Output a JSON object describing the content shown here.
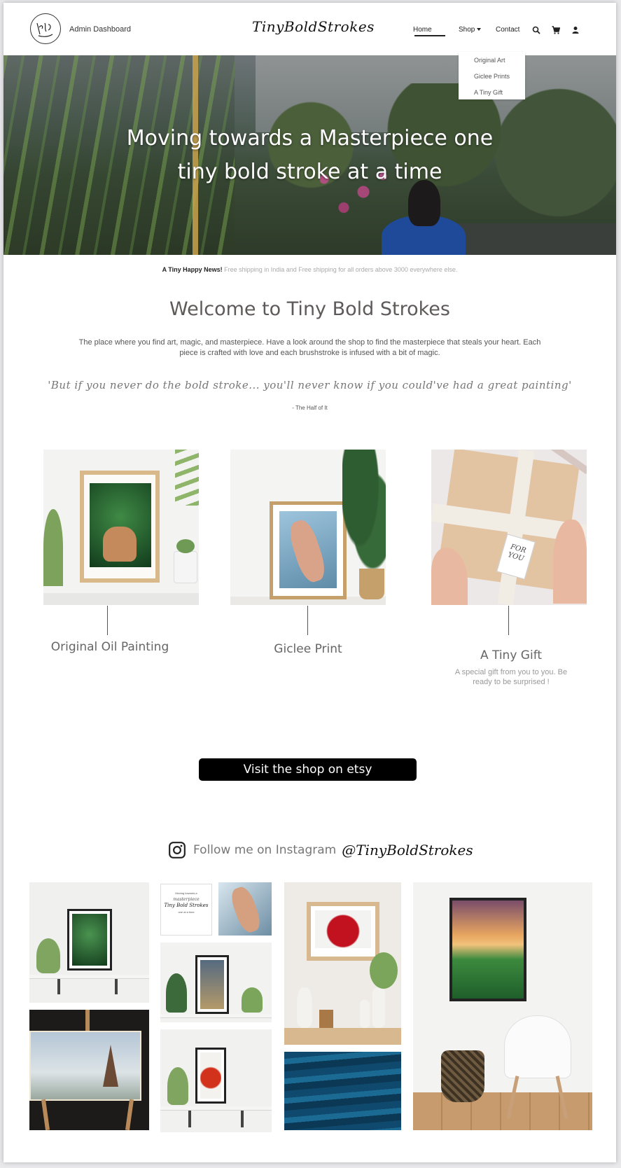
{
  "header": {
    "logo_text": "Tiny Bold Strokes",
    "admin_label": "Admin Dashboard",
    "brand": "TinyBoldStrokes",
    "nav": {
      "home": "Home",
      "shop": "Shop",
      "contact": "Contact"
    },
    "icons": [
      "search-icon",
      "cart-icon",
      "user-icon"
    ],
    "shop_dropdown": [
      "Original Art",
      "Giclee Prints",
      "A Tiny Gift"
    ]
  },
  "hero": {
    "line1": "Moving towards a Masterpiece one",
    "line2": "tiny bold stroke at a time"
  },
  "news": {
    "label": "A Tiny Happy News!",
    "text": "Free shipping in India and Free shipping for all orders above 3000 everywhere else."
  },
  "welcome": {
    "title": "Welcome to Tiny Bold Strokes",
    "intro": "The place where you find art, magic, and masterpiece. Have a look around the shop to find the masterpiece that steals your heart. Each piece is crafted with love and each brushstroke is infused with a bit of magic.",
    "quote": "'But if you never do the bold stroke... you'll never know if you could've had a great painting'",
    "quote_source": "- The Half of It"
  },
  "products": [
    {
      "title": "Original Oil Painting",
      "desc": ""
    },
    {
      "title": "Giclee Print",
      "desc": ""
    },
    {
      "title": "A Tiny Gift",
      "desc": "A special gift from you to you. Be ready to be surprised !"
    }
  ],
  "gift_tag": "FOR YOU",
  "cta": {
    "etsy": "Visit the shop on etsy"
  },
  "instagram": {
    "text": "Follow me on Instagram",
    "handle": "@TinyBoldStrokes",
    "teaser_lines": [
      "Moving towards a",
      "masterpiece",
      "Tiny Bold Strokes",
      "one at a time"
    ]
  },
  "colors": {
    "text": "#555555",
    "button": "#000000",
    "hero_text": "#ffffff"
  }
}
